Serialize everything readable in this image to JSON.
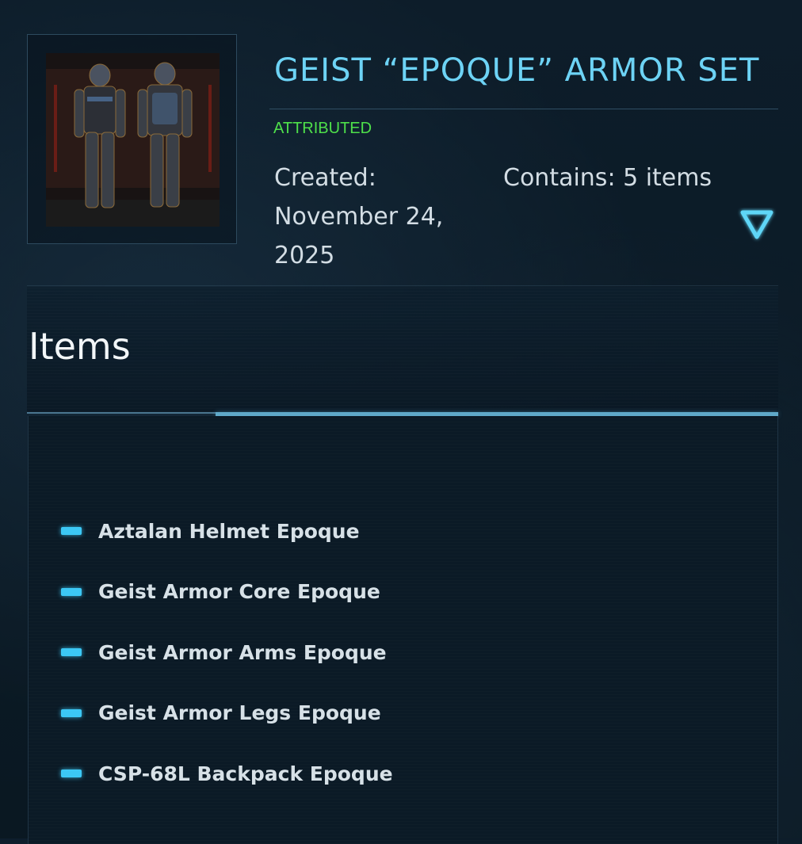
{
  "product": {
    "title": "GEIST “EPOQUE” ARMOR SET",
    "badge": "ATTRIBUTED",
    "created_label": "Created:",
    "created_date": "November 24, 2025",
    "contains": "Contains: 5 items",
    "image_alt": "armor-set-thumbnail"
  },
  "items_section": {
    "heading": "Items",
    "items": [
      {
        "label": "Aztalan Helmet Epoque"
      },
      {
        "label": "Geist Armor Core Epoque"
      },
      {
        "label": "Geist Armor Arms Epoque"
      },
      {
        "label": "Geist Armor Legs Epoque"
      },
      {
        "label": "CSP-68L Backpack Epoque"
      }
    ]
  },
  "icons": {
    "expand": "triangle-down-icon",
    "bullet": "dash-bullet-icon"
  },
  "colors": {
    "accent": "#6dd3f5",
    "badge": "#4ee04a",
    "bullet": "#3cc8f5",
    "background": "#0b1a26"
  }
}
